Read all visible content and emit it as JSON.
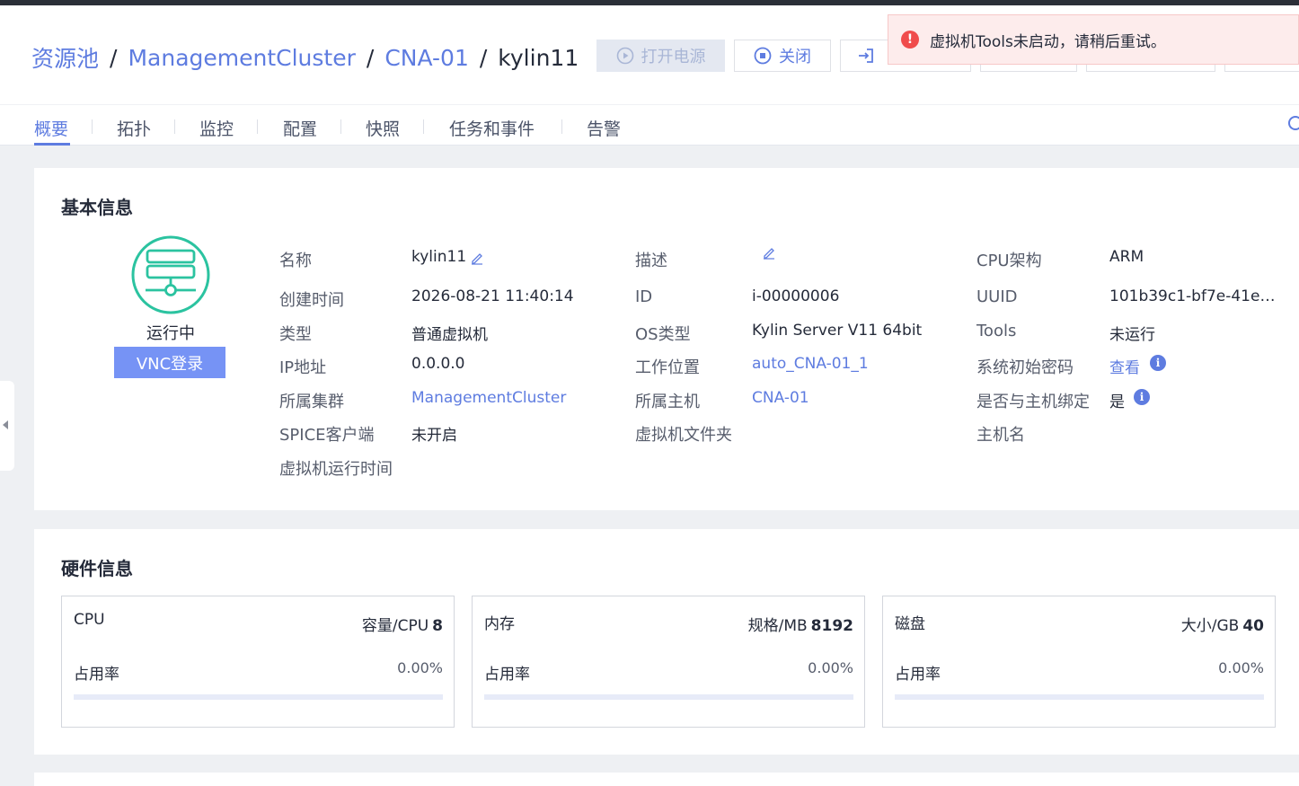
{
  "breadcrumb": {
    "items": [
      "资源池",
      "ManagementCluster",
      "CNA-01"
    ],
    "current": "kylin11",
    "separator": "/"
  },
  "actions": {
    "power_on": "打开电源",
    "shutdown": "关闭"
  },
  "toast": {
    "message": "虚拟机Tools未启动，请稍后重试。",
    "type": "error"
  },
  "tabs": [
    "概要",
    "拓扑",
    "监控",
    "配置",
    "快照",
    "任务和事件",
    "告警"
  ],
  "active_tab": "概要",
  "basic_info": {
    "title": "基本信息",
    "status": "运行中",
    "vnc_button": "VNC登录",
    "col1": [
      {
        "label": "名称",
        "value": "kylin11"
      },
      {
        "label": "创建时间",
        "value": "2026-08-21 11:40:14"
      },
      {
        "label": "类型",
        "value": "普通虚拟机"
      },
      {
        "label": "IP地址",
        "value": "0.0.0.0"
      },
      {
        "label": "所属集群",
        "value": "ManagementCluster"
      },
      {
        "label": "SPICE客户端",
        "value": "未开启"
      },
      {
        "label": "虚拟机运行时间",
        "value": ""
      }
    ],
    "col2": [
      {
        "label": "描述",
        "value": ""
      },
      {
        "label": "ID",
        "value": "i-00000006"
      },
      {
        "label": "OS类型",
        "value": "Kylin Server V11 64bit"
      },
      {
        "label": "工作位置",
        "value": "auto_CNA-01_1"
      },
      {
        "label": "所属主机",
        "value": "CNA-01"
      },
      {
        "label": "虚拟机文件夹",
        "value": ""
      }
    ],
    "col3": [
      {
        "label": "CPU架构",
        "value": "ARM"
      },
      {
        "label": "UUID",
        "value": "101b39c1-bf7e-41e…"
      },
      {
        "label": "Tools",
        "value": "未运行"
      },
      {
        "label": "系统初始密码",
        "value": "查看"
      },
      {
        "label": "是否与主机绑定",
        "value": "是"
      },
      {
        "label": "主机名",
        "value": ""
      }
    ]
  },
  "hardware_info": {
    "title": "硬件信息",
    "usage_label": "占用率",
    "items": [
      {
        "name": "CPU",
        "spec_label": "容量/CPU",
        "spec_value": "8",
        "usage": "0.00%",
        "usage_fraction": 0
      },
      {
        "name": "内存",
        "spec_label": "规格/MB",
        "spec_value": "8192",
        "usage": "0.00%",
        "usage_fraction": 0
      },
      {
        "name": "磁盘",
        "spec_label": "大小/GB",
        "spec_value": "40",
        "usage": "0.00%",
        "usage_fraction": 0
      }
    ]
  },
  "colors": {
    "accent": "#5e7ce0",
    "running": "#2bc3a0",
    "error": "#f04c4c"
  }
}
